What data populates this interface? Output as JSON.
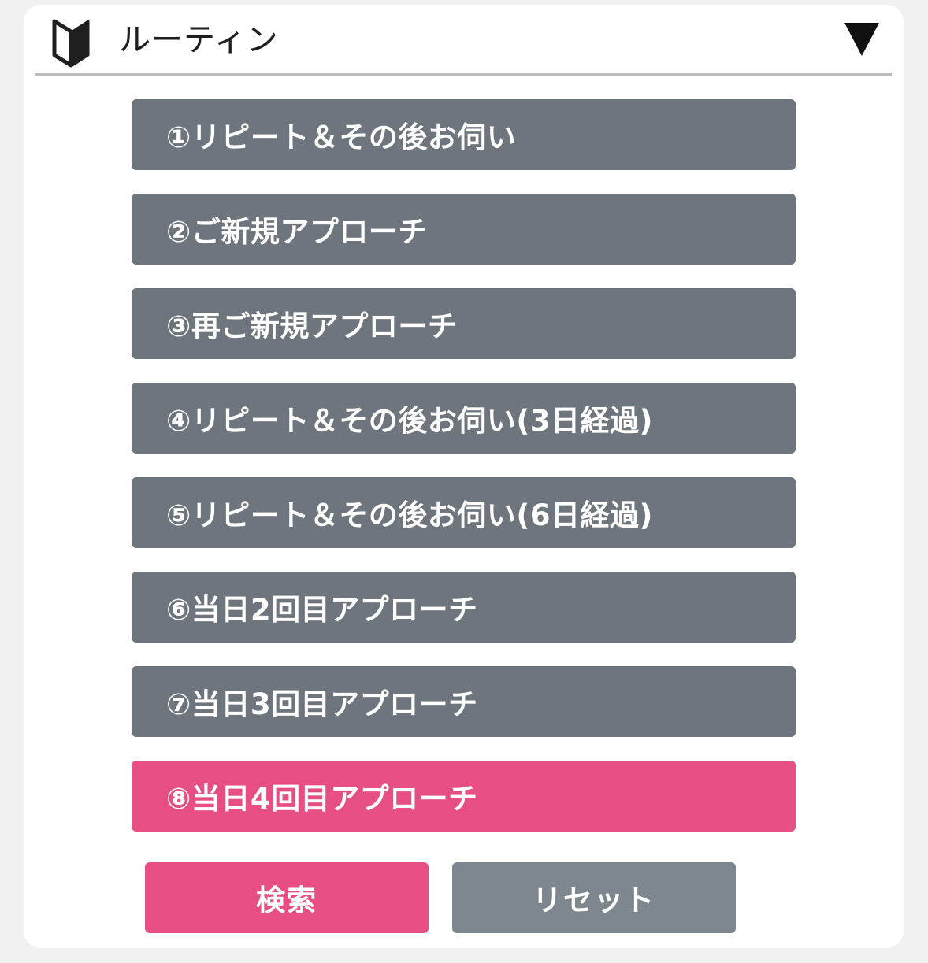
{
  "header": {
    "icon": "beginner-mark-icon",
    "title": "ルーティン",
    "dropdown_icon": "triangle-down-icon"
  },
  "options": [
    {
      "label": "①リピート＆その後お伺い",
      "selected": false
    },
    {
      "label": "②ご新規アプローチ",
      "selected": false
    },
    {
      "label": "③再ご新規アプローチ",
      "selected": false
    },
    {
      "label": "④リピート＆その後お伺い(3日経過)",
      "selected": false
    },
    {
      "label": "⑤リピート＆その後お伺い(6日経過)",
      "selected": false
    },
    {
      "label": "⑥当日2回目アプローチ",
      "selected": false
    },
    {
      "label": "⑦当日3回目アプローチ",
      "selected": false
    },
    {
      "label": "⑧当日4回目アプローチ",
      "selected": true
    }
  ],
  "actions": {
    "search_label": "検索",
    "reset_label": "リセット"
  },
  "colors": {
    "option_default": "#6e757d",
    "option_selected": "#e74f84",
    "search_button": "#e74f84",
    "reset_button": "#7f878e"
  }
}
